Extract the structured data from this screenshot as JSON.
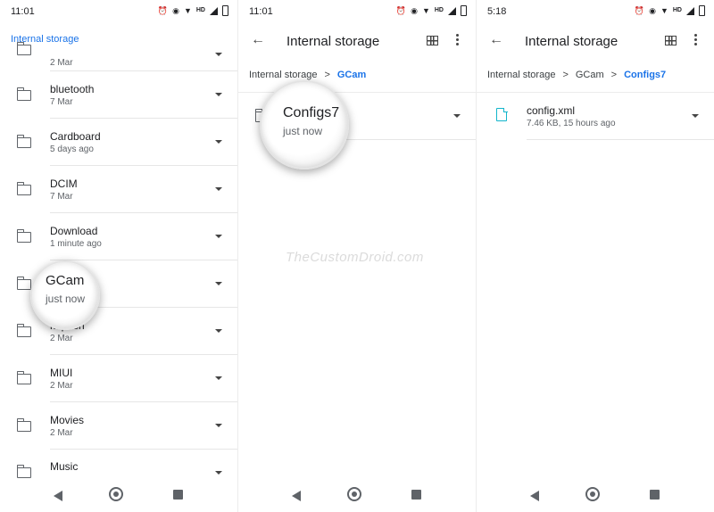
{
  "panel1": {
    "time": "11:01",
    "header_title": "Internal storage",
    "items": [
      {
        "name": "",
        "sub": "2 Mar"
      },
      {
        "name": "bluetooth",
        "sub": "7 Mar"
      },
      {
        "name": "Cardboard",
        "sub": "5 days ago"
      },
      {
        "name": "DCIM",
        "sub": "7 Mar"
      },
      {
        "name": "Download",
        "sub": "1 minute ago"
      },
      {
        "name": "GCam",
        "sub": "just now"
      },
      {
        "name": "mipush",
        "sub": "2 Mar"
      },
      {
        "name": "MIUI",
        "sub": "2 Mar"
      },
      {
        "name": "Movies",
        "sub": "2 Mar"
      },
      {
        "name": "Music",
        "sub": ""
      }
    ],
    "magnifier": {
      "name": "GCam",
      "sub": "just now"
    }
  },
  "panel2": {
    "time": "11:01",
    "title": "Internal storage",
    "breadcrumb": [
      "Internal storage",
      "GCam"
    ],
    "items": [
      {
        "name": "Configs7",
        "sub": "just now"
      }
    ],
    "magnifier": {
      "name": "Configs7",
      "sub": "just now"
    }
  },
  "panel3": {
    "time": "5:18",
    "title": "Internal storage",
    "breadcrumb": [
      "Internal storage",
      "GCam",
      "Configs7"
    ],
    "items": [
      {
        "name": "config.xml",
        "sub": "7.46 KB, 15 hours ago"
      }
    ]
  },
  "status": {
    "hd_label": "HD"
  },
  "icons": {
    "back": "arrow-left-icon",
    "grid": "grid-view-icon",
    "more": "more-vert-icon",
    "folder": "folder-icon",
    "file": "file-icon"
  },
  "watermark": "TheCustomDroid.com",
  "colors": {
    "accent": "#1a73e8",
    "file_icon": "#12b5cb"
  }
}
